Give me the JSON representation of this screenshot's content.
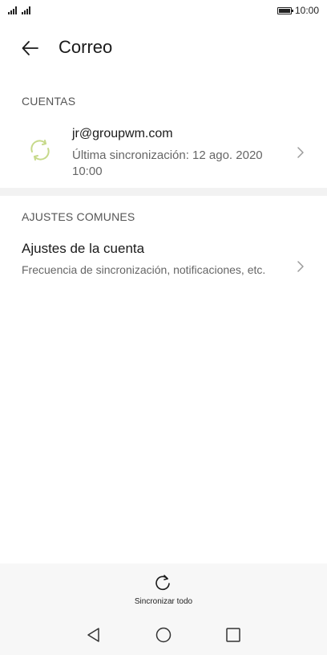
{
  "status_bar": {
    "time": "10:00",
    "battery_icon": "battery-icon",
    "signal_icons": [
      "signal-icon",
      "signal-icon"
    ]
  },
  "header": {
    "title": "Correo",
    "back_icon": "arrow-left-icon"
  },
  "accounts": {
    "section_label": "CUENTAS",
    "items": [
      {
        "email": "jr@groupwm.com",
        "subtitle": "Última sincronización: 12 ago. 2020 10:00",
        "icon": "sync-icon",
        "icon_color": "#c6d98a"
      }
    ]
  },
  "common": {
    "section_label": "AJUSTES COMUNES",
    "items": [
      {
        "title": "Ajustes de la cuenta",
        "subtitle": "Frecuencia de sincronización, notificaciones, etc."
      }
    ]
  },
  "bottom_action": {
    "label": "Sincronizar todo",
    "icon": "refresh-icon"
  },
  "nav": {
    "back_icon": "nav-back-icon",
    "home_icon": "nav-home-icon",
    "recents_icon": "nav-recents-icon"
  }
}
